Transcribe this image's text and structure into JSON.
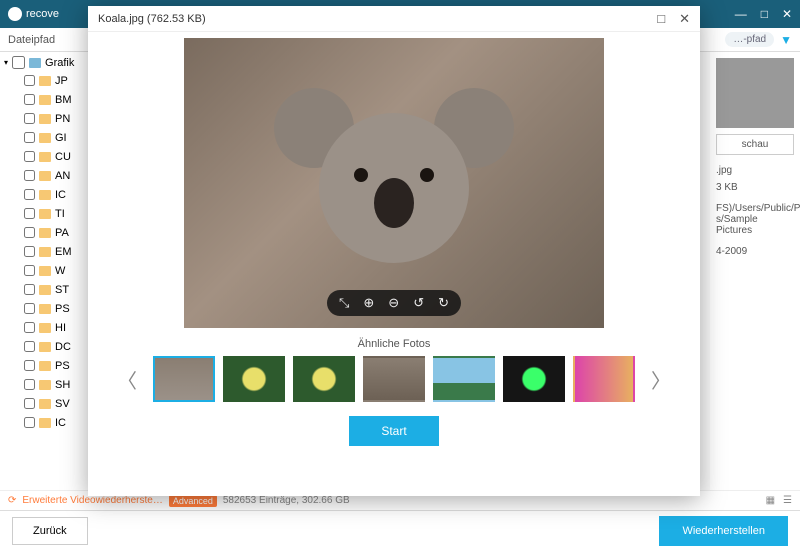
{
  "header": {
    "brand": "recove",
    "min": "—",
    "max": "□",
    "close": "✕"
  },
  "subheader": {
    "path_label": "Dateipfad",
    "filter_placeholder": "…-pfad",
    "funnel": "▼"
  },
  "tree": {
    "root_label": "Grafik",
    "items": [
      "JP",
      "BM",
      "PN",
      "GI",
      "CU",
      "AN",
      "IC",
      "TI",
      "PA",
      "EM",
      "W",
      "ST",
      "PS",
      "HI",
      "DC",
      "PS",
      "SH",
      "SV",
      "IC"
    ]
  },
  "right": {
    "preview_button": "schau",
    "file_ext": ".jpg",
    "size_fragment": "3  KB",
    "path_fragment_1": "FS)/Users/Public/Pi",
    "path_fragment_2": "s/Sample Pictures",
    "date_fragment": "4-2009"
  },
  "status": {
    "adv_text": "Erweiterte Videowiederherste…",
    "adv_badge": "Advanced",
    "entries": "582653 Einträge, 302.66  GB"
  },
  "footer": {
    "back": "Zurück",
    "recover": "Wiederherstellen"
  },
  "modal": {
    "title": "Koala.jpg (762.53  KB)",
    "max": "□",
    "close": "✕",
    "similar_label": "Ähnliche Fotos",
    "start": "Start",
    "toolbar": {
      "fit": "⤡",
      "zoom_in": "⊕",
      "zoom_out": "⊖",
      "rotate_left": "↺",
      "rotate_right": "↻"
    },
    "nav_prev": "〈",
    "nav_next": "〉"
  }
}
